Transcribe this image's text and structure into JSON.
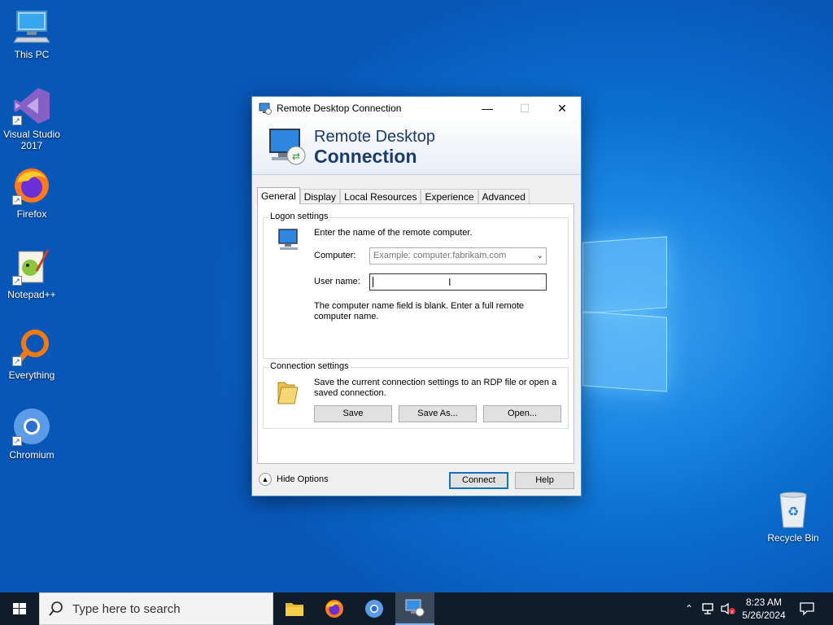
{
  "desktop": {
    "icons": [
      {
        "label": "This PC"
      },
      {
        "label": "Visual Studio 2017"
      },
      {
        "label": "Firefox"
      },
      {
        "label": "Notepad++"
      },
      {
        "label": "Everything"
      },
      {
        "label": "Chromium"
      },
      {
        "label": "Recycle Bin"
      }
    ]
  },
  "dialog": {
    "title": "Remote Desktop Connection",
    "controls": {
      "minimize": "—",
      "maximize": "☐",
      "close": "✕"
    },
    "banner": {
      "line1": "Remote Desktop",
      "line2": "Connection"
    },
    "tabs": [
      "General",
      "Display",
      "Local Resources",
      "Experience",
      "Advanced"
    ],
    "active_tab": "General",
    "logon": {
      "legend": "Logon settings",
      "instruction": "Enter the name of the remote computer.",
      "computer_label": "Computer:",
      "computer_placeholder": "Example: computer.fabrikam.com",
      "username_label": "User name:",
      "username_value": "",
      "message": "The computer name field is blank. Enter a full remote computer name."
    },
    "connection": {
      "legend": "Connection settings",
      "description": "Save the current connection settings to an RDP file or open a saved connection.",
      "save": "Save",
      "save_as": "Save As...",
      "open": "Open..."
    },
    "hide_options": "Hide Options",
    "connect": "Connect",
    "help": "Help"
  },
  "taskbar": {
    "search_placeholder": "Type here to search",
    "apps": [
      "file-explorer",
      "firefox",
      "chromium",
      "remote-desktop"
    ],
    "active_app": "remote-desktop",
    "time": "8:23 AM",
    "date": "5/26/2024"
  },
  "colors": {
    "desktop": "#0b6fd0",
    "taskbar": "#101c2a",
    "banner_text": "#1d3a6e",
    "default_button_border": "#1a6fc9"
  }
}
